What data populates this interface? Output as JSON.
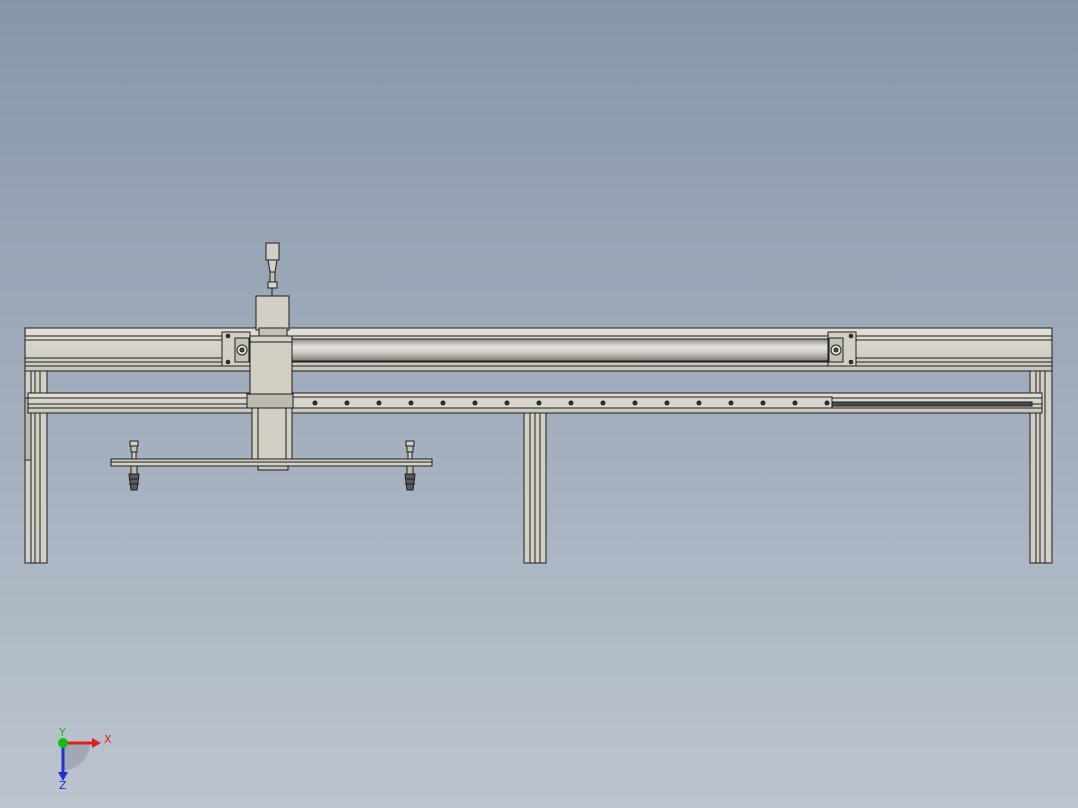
{
  "viewport": {
    "background_top": "#8797aa",
    "background_bottom": "#bcc4cf"
  },
  "model": {
    "part_fill": "#d2d0c4",
    "part_fill_dark": "#b9b7ab",
    "edge_color": "#1e1e1e",
    "rod_light": "#e6e4dc",
    "rod_dark": "#8e8c84"
  },
  "triad": {
    "x_label": "X",
    "y_label": "Y",
    "z_label": "Z",
    "x_color": "#e02020",
    "y_color": "#10c010",
    "z_color": "#2030d0"
  }
}
